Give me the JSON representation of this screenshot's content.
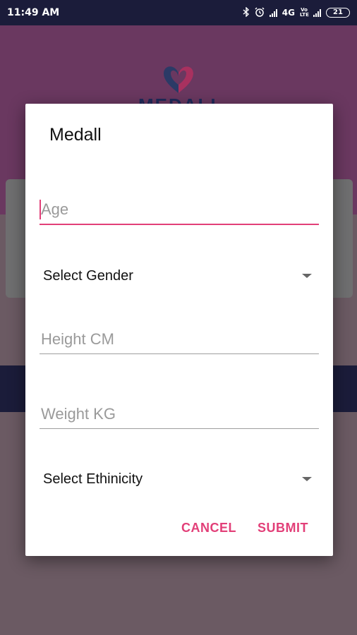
{
  "status_bar": {
    "time": "11:49 AM",
    "network": "4G",
    "lte_label": "Vo LTE",
    "battery": "21",
    "icons": [
      "bluetooth-icon",
      "alarm-icon",
      "signal-icon",
      "signal-icon-2",
      "battery-icon"
    ]
  },
  "background": {
    "logo_text": "MEDALL",
    "colors": {
      "header": "#6a3860",
      "navy": "#1b1c3a",
      "logo_blue": "#1f2a5a",
      "logo_pink": "#c2185b"
    }
  },
  "dialog": {
    "title": "Medall",
    "age_placeholder": "Age",
    "gender_select": "Select Gender",
    "height_placeholder": "Height CM",
    "weight_placeholder": "Weight KG",
    "ethnicity_select": "Select Ethinicity",
    "cancel_label": "CANCEL",
    "submit_label": "SUBMIT",
    "accent_color": "#e23f78"
  }
}
